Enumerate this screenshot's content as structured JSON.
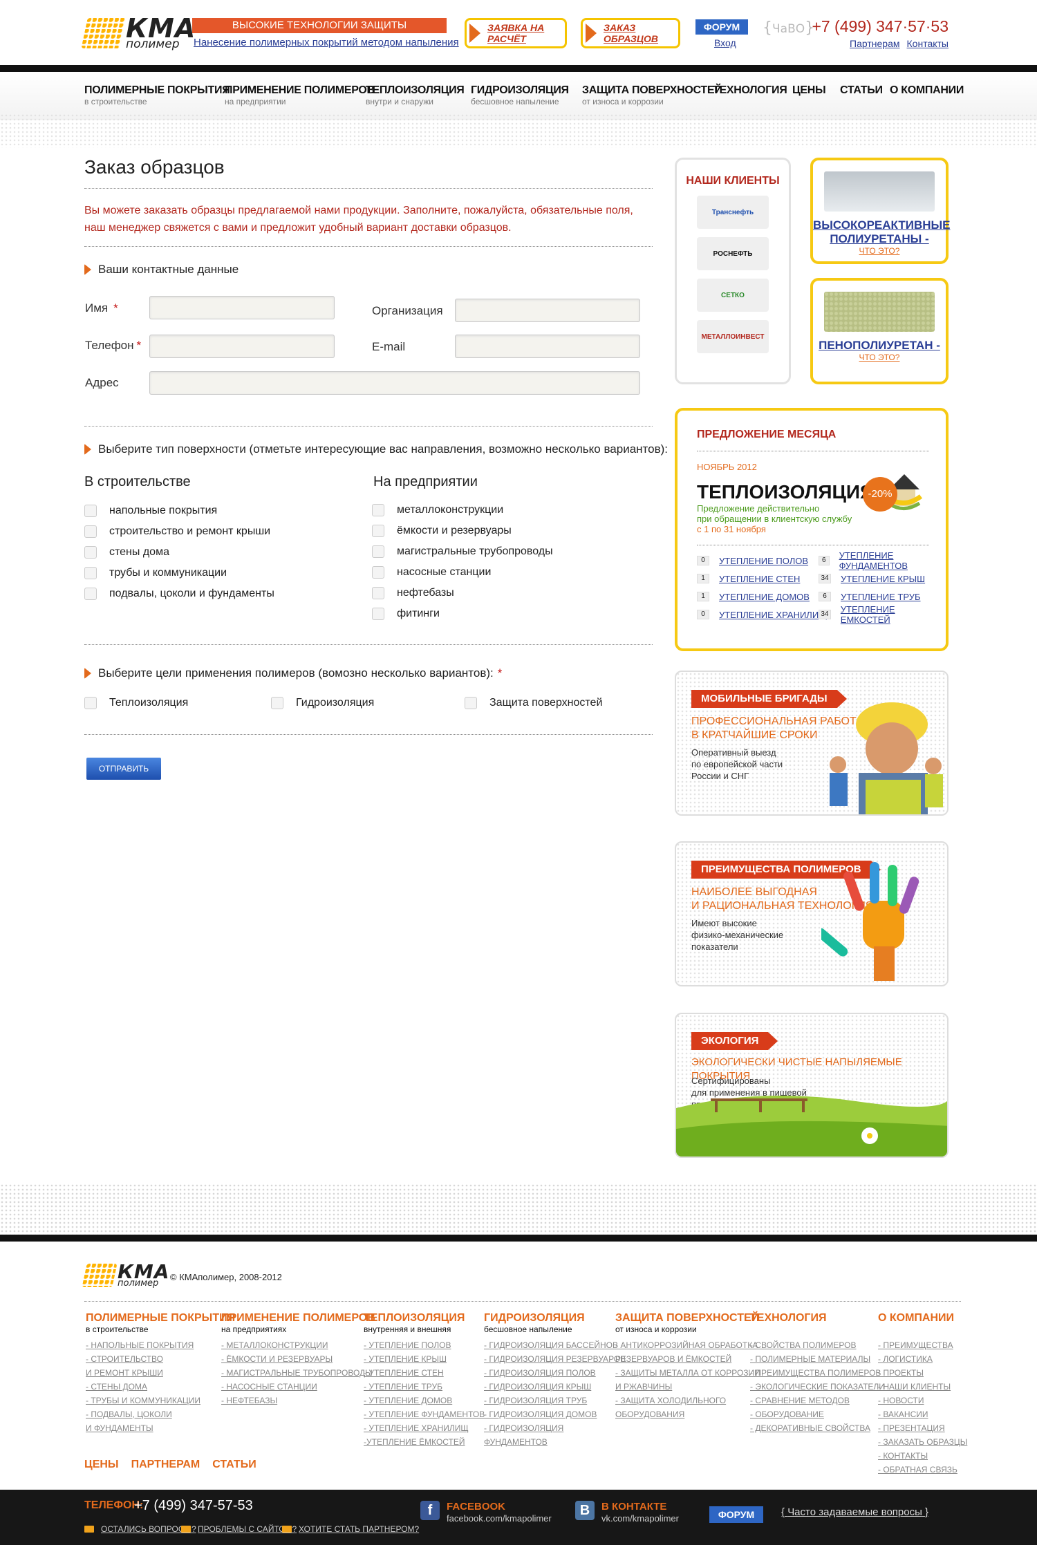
{
  "header": {
    "logo_main": "КМА",
    "logo_sub": "полимер",
    "tagline": "ВЫСОКИЕ ТЕХНОЛОГИИ ЗАЩИТЫ ПОВЕРХНОСТЕЙ",
    "tagline_sub": "Нанесение полимерных покрытий методом напыления",
    "btn_calc": "ЗАЯВКА НА РАСЧЁТ",
    "btn_samples": "ЗАКАЗ ОБРАЗЦОВ",
    "forum": "ФОРУМ",
    "login": "Вход",
    "faq": "ЧаВО",
    "phone": "+7 (499) 347·57·53",
    "partners": "Партнерам",
    "contacts": "Контакты"
  },
  "nav": [
    {
      "label": "ПОЛИМЕРНЫЕ ПОКРЫТИЯ",
      "sub": "в строительстве"
    },
    {
      "label": "ПРИМЕНЕНИЕ ПОЛИМЕРОВ",
      "sub": "на предприятии"
    },
    {
      "label": "ТЕПЛОИЗОЛЯЦИЯ",
      "sub": "внутри и снаружи"
    },
    {
      "label": "ГИДРОИЗОЛЯЦИЯ",
      "sub": "бесшовное напыление"
    },
    {
      "label": "ЗАЩИТА ПОВЕРХНОСТЕЙ",
      "sub": "от износа и коррозии"
    },
    {
      "label": "ТЕХНОЛОГИЯ",
      "sub": ""
    },
    {
      "label": "ЦЕНЫ",
      "sub": ""
    },
    {
      "label": "СТАТЬИ",
      "sub": ""
    },
    {
      "label": "О КОМПАНИИ",
      "sub": ""
    }
  ],
  "form": {
    "title": "Заказ образцов",
    "intro": "Вы можете заказать образцы предлагаемой нами продукции. Заполните, пожалуйста, обязательные поля, наш менеджер свяжется с вами и предложит удобный вариант доставки образцов.",
    "contacts_heading": "Ваши контактные данные",
    "name": "Имя",
    "org": "Организация",
    "phone": "Телефон",
    "email": "E-mail",
    "address": "Адрес",
    "required": "*",
    "surface_heading": "Выберите тип поверхности (отметьте интересующие вас направления, возможно несколько вариантов):",
    "col1_title": "В строительстве",
    "col1": [
      "напольные покрытия",
      "строительство и ремонт крыши",
      "стены дома",
      "трубы и коммуникации",
      "подвалы, цоколи и фундаменты"
    ],
    "col2_title": "На предприятии",
    "col2": [
      "металлоконструкции",
      "ёмкости и резервуары",
      "магистральные трубопроводы",
      "насосные станции",
      "нефтебазы",
      "фитинги"
    ],
    "goals_heading": "Выберите цели применения полимеров (вомозно несколько вариантов):",
    "goals": [
      "Теплоизоляция",
      "Гидроизоляция",
      "Защита поверхностей"
    ],
    "submit": "ОТПРАВИТЬ"
  },
  "clients": {
    "title": "НАШИ КЛИЕНТЫ",
    "logos": [
      "Транснефть",
      "РОСНЕФТЬ",
      "СЕТКО",
      "МЕТАЛЛОИНВЕСТ"
    ]
  },
  "ads": [
    {
      "title": "ВЫСОКОРЕАКТИВНЫЕ ПОЛИУРЕТАНЫ -",
      "what": "ЧТО ЭТО?"
    },
    {
      "title": "ПЕНОПОЛИУРЕТАН -",
      "what": "ЧТО ЭТО?"
    }
  ],
  "offer": {
    "title": "ПРЕДЛОЖЕНИЕ МЕСЯЦА",
    "month": "НОЯБРЬ 2012",
    "big": "ТЕПЛОИЗОЛЯЦИЯ",
    "discount": "-20%",
    "line1": "Предложение действительно",
    "line2": "при обращении в клиентскую службу",
    "line3": "с 1 по 31 ноября",
    "left": [
      {
        "n": "0",
        "l": "УТЕПЛЕНИЕ ПОЛОВ"
      },
      {
        "n": "1",
        "l": "УТЕПЛЕНИЕ СТЕН"
      },
      {
        "n": "1",
        "l": "УТЕПЛЕНИЕ ДОМОВ"
      },
      {
        "n": "0",
        "l": "УТЕПЛЕНИЕ ХРАНИЛИЩ"
      }
    ],
    "right": [
      {
        "n": "6",
        "l": "УТЕПЛЕНИЕ ФУНДАМЕНТОВ"
      },
      {
        "n": "34",
        "l": "УТЕПЛЕНИЕ КРЫШ"
      },
      {
        "n": "6",
        "l": "УТЕПЛЕНИЕ ТРУБ"
      },
      {
        "n": "34",
        "l": "УТЕПЛЕНИЕ ЕМКОСТЕЙ"
      }
    ]
  },
  "promos": [
    {
      "tag": "МОБИЛЬНЫЕ БРИГАДЫ",
      "sub1": "ПРОФЕССИОНАЛЬНАЯ РАБОТА",
      "sub2": "В КРАТЧАЙШИЕ СРОКИ",
      "t1": "Оперативный выезд",
      "t2": "по европейской части",
      "t3": "России и СНГ"
    },
    {
      "tag": "ПРЕИМУЩЕСТВА ПОЛИМЕРОВ",
      "sub1": "НАИБОЛЕЕ ВЫГОДНАЯ",
      "sub2": "И РАЦИОНАЛЬНАЯ ТЕХНОЛОГИЯ",
      "t1": "Имеют высокие",
      "t2": "физико-механические",
      "t3": "показатели"
    },
    {
      "tag": "ЭКОЛОГИЯ",
      "sub1": "ЭКОЛОГИЧЕСКИ ЧИСТЫЕ НАПЫЛЯЕМЫЕ ПОКРЫТИЯ",
      "sub2": "",
      "t1": "Сертифицированы",
      "t2": "для применения в пищевой",
      "t3": "промышленности"
    }
  ],
  "footer": {
    "copyright": "© КМАполимер, 2008-2012",
    "cols": [
      {
        "h": "ПОЛИМЕРНЫЕ ПОКРЫТИЯ",
        "s": "в строительстве",
        "links": [
          "- НАПОЛЬНЫЕ ПОКРЫТИЯ",
          "- СТРОИТЕЛЬСТВО",
          "И РЕМОНТ КРЫШИ",
          "- СТЕНЫ ДОМА",
          "- ТРУБЫ И КОММУНИКАЦИИ",
          "- ПОДВАЛЫ, ЦОКОЛИ",
          "И ФУНДАМЕНТЫ"
        ]
      },
      {
        "h": "ПРИМЕНЕНИЕ ПОЛИМЕРОВ",
        "s": "на предприятиях",
        "links": [
          "- МЕТАЛЛОКОНСТРУКЦИИ",
          "- ЁМКОСТИ И РЕЗЕРВУАРЫ",
          "- МАГИСТРАЛЬНЫЕ ТРУБОПРОВОДЫ",
          "- НАСОСНЫЕ СТАНЦИИ",
          "- НЕФТЕБАЗЫ"
        ]
      },
      {
        "h": "ТЕПЛОИЗОЛЯЦИЯ",
        "s": "внутренняя и внешняя",
        "links": [
          "- УТЕПЛЕНИЕ ПОЛОВ",
          "- УТЕПЛЕНИЕ КРЫШ",
          "- УТЕПЛЕНИЕ СТЕН",
          "- УТЕПЛЕНИЕ ТРУБ",
          "- УТЕПЛЕНИЕ ДОМОВ",
          "- УТЕПЛЕНИЕ ФУНДАМЕНТОВ",
          "- УТЕПЛЕНИЕ ХРАНИЛИЩ",
          "-УТЕПЛЕНИЕ ЁМКОСТЕЙ"
        ]
      },
      {
        "h": "ГИДРОИЗОЛЯЦИЯ",
        "s": "бесшовное напыление",
        "links": [
          "- ГИДРОИЗОЛЯЦИЯ БАССЕЙНОВ",
          "- ГИДРОИЗОЛЯЦИЯ РЕЗЕРВУАРОВ",
          "- ГИДРОИЗОЛЯЦИЯ ПОЛОВ",
          "- ГИДРОИЗОЛЯЦИЯ КРЫШ",
          "- ГИДРОИЗОЛЯЦИЯ ТРУБ",
          "- ГИДРОИЗОЛЯЦИЯ ДОМОВ",
          "- ГИДРОИЗОЛЯЦИЯ",
          "ФУНДАМЕНТОВ"
        ]
      },
      {
        "h": "ЗАЩИТА ПОВЕРХНОСТЕЙ",
        "s": "от износа и коррозии",
        "links": [
          "- АНТИКОРРОЗИЙНАЯ ОБРАБОТКА",
          "РЕЗЕРВУАРОВ И ЁМКОСТЕЙ",
          "- ЗАЩИТЫ МЕТАЛЛА ОТ КОРРОЗИИ",
          "И РЖАВЧИНЫ",
          "- ЗАЩИТА ХОЛОДИЛЬНОГО",
          "ОБОРУДОВАНИЯ"
        ]
      },
      {
        "h": "ТЕХНОЛОГИЯ",
        "s": "",
        "links": [
          "- СВОЙСТВА ПОЛИМЕРОВ",
          "- ПОЛИМЕРНЫЕ МАТЕРИАЛЫ",
          "- ПРЕИМУЩЕСТВА ПОЛИМЕРОВ",
          "- ЭКОЛОГИЧЕСКИЕ ПОКАЗАТЕЛИ",
          "- СРАВНЕНИЕ МЕТОДОВ",
          "- ОБОРУДОВАНИЕ",
          "- ДЕКОРАТИВНЫЕ СВОЙСТВА"
        ]
      },
      {
        "h": "О КОМПАНИИ",
        "s": "",
        "links": [
          "- ПРЕИМУЩЕСТВА",
          "- ЛОГИСТИКА",
          "- ПРОЕКТЫ",
          "- НАШИ КЛИЕНТЫ",
          "- НОВОСТИ",
          "- ВАКАНСИИ",
          "- ПРЕЗЕНТАЦИЯ",
          "- ЗАКАЗАТЬ ОБРАЗЦЫ",
          "- КОНТАКТЫ",
          "- ОБРАТНАЯ СВЯЗЬ"
        ]
      }
    ],
    "menu": [
      "ЦЕНЫ",
      "ПАРТНЕРАМ",
      "СТАТЬИ"
    ],
    "phone_label": "ТЕЛЕФОН:",
    "phone": "+7 (499) 347-57-53",
    "link1": "ОСТАЛИСЬ ВОПРОСЫ?",
    "link2": "ПРОБЛЕМЫ С САЙТОМ?",
    "link3": "ХОТИТЕ СТАТЬ ПАРТНЕРОМ?",
    "fb_title": "FACEBOOK",
    "fb_url": "facebook.com/kmapolimer",
    "vk_title": "В КОНТАКТЕ",
    "vk_url": "vk.com/kmapolimer",
    "forum": "ФОРУМ",
    "faq": "Часто задаваемые вопросы"
  }
}
